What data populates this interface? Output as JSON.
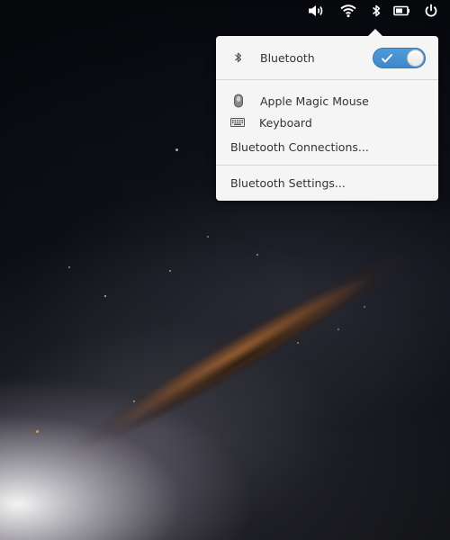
{
  "panel": {
    "indicators": [
      {
        "name": "volume-icon"
      },
      {
        "name": "wifi-icon"
      },
      {
        "name": "bluetooth-icon"
      },
      {
        "name": "battery-icon"
      },
      {
        "name": "power-icon"
      }
    ]
  },
  "popover": {
    "bluetooth_label": "Bluetooth",
    "bluetooth_enabled": true,
    "devices": [
      {
        "icon": "mouse-icon",
        "label": "Apple Magic Mouse"
      },
      {
        "icon": "keyboard-icon",
        "label": "Keyboard"
      }
    ],
    "connections_label": "Bluetooth Connections...",
    "settings_label": "Bluetooth Settings..."
  },
  "colors": {
    "accent": "#4a93d4",
    "popover_bg": "#f5f5f5",
    "text": "#333333"
  }
}
